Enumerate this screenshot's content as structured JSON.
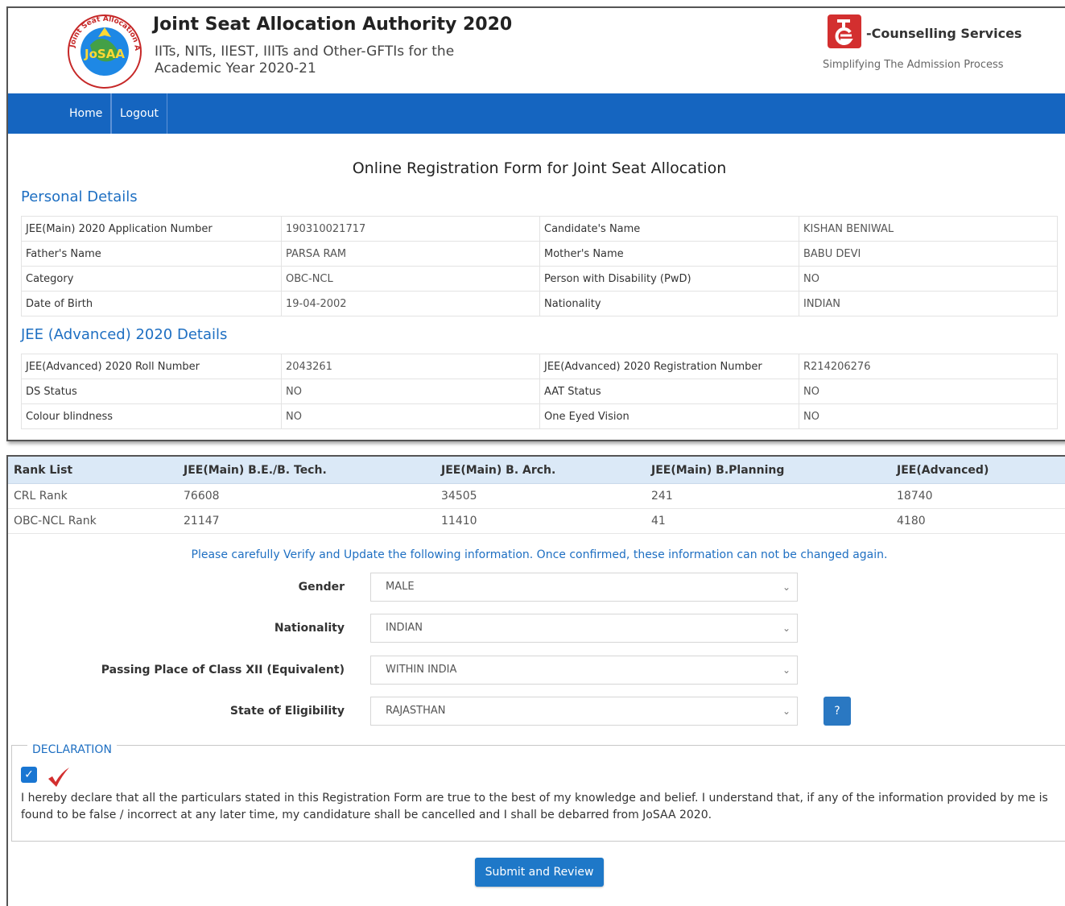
{
  "header": {
    "logo_text_top": "Joint Seat Allocation Authority",
    "logo_center": "JoSAA",
    "title": "Joint Seat Allocation Authority 2020",
    "subtitle_line1": "IITs, NITs, IIEST, IIITs and Other-GFTIs for the",
    "subtitle_line2": "Academic Year 2020-21",
    "ec_title": "-Counselling Services",
    "ec_tagline": "Simplifying The Admission Process"
  },
  "nav": {
    "items": [
      "Home",
      "Logout"
    ]
  },
  "form_heading": "Online Registration Form for Joint Seat Allocation",
  "personal": {
    "title": "Personal Details",
    "rows": [
      [
        "JEE(Main) 2020 Application Number",
        "190310021717",
        "Candidate's Name",
        "KISHAN BENIWAL"
      ],
      [
        "Father's Name",
        "PARSA RAM",
        "Mother's Name",
        "BABU DEVI"
      ],
      [
        "Category",
        "OBC-NCL",
        "Person with Disability (PwD)",
        "NO"
      ],
      [
        "Date of Birth",
        "19-04-2002",
        "Nationality",
        "INDIAN"
      ]
    ]
  },
  "advanced": {
    "title": "JEE (Advanced) 2020 Details",
    "rows": [
      [
        "JEE(Advanced) 2020 Roll Number",
        "2043261",
        "JEE(Advanced) 2020 Registration Number",
        "R214206276"
      ],
      [
        "DS Status",
        "NO",
        "AAT Status",
        "NO"
      ],
      [
        "Colour blindness",
        "NO",
        "One Eyed Vision",
        "NO"
      ]
    ]
  },
  "rank": {
    "headers": [
      "Rank List",
      "JEE(Main) B.E./B. Tech.",
      "JEE(Main) B. Arch.",
      "JEE(Main) B.Planning",
      "JEE(Advanced)"
    ],
    "rows": [
      [
        "CRL Rank",
        "76608",
        "34505",
        "241",
        "18740"
      ],
      [
        "OBC-NCL Rank",
        "21147",
        "11410",
        "41",
        "4180"
      ]
    ]
  },
  "verify_note": "Please carefully Verify and Update the following information. Once confirmed, these information can not be changed again.",
  "fields": [
    {
      "label": "Gender",
      "value": "MALE"
    },
    {
      "label": "Nationality",
      "value": "INDIAN"
    },
    {
      "label": "Passing Place of Class XII (Equivalent)",
      "value": "WITHIN INDIA"
    },
    {
      "label": "State of Eligibility",
      "value": "RAJASTHAN"
    }
  ],
  "help_label": "?",
  "declaration": {
    "legend": "DECLARATION",
    "checked": true,
    "text": "I hereby declare that all the particulars stated in this Registration Form are true to the best of my knowledge and belief. I understand that, if any of the information provided by me is found to be false / incorrect at any later time, my candidature shall be cancelled and I shall be debarred from JoSAA 2020."
  },
  "submit_label": "Submit and Review",
  "colors": {
    "accent": "#1565c0",
    "link": "#1e6fc2",
    "header_row": "#dbe9f7"
  }
}
